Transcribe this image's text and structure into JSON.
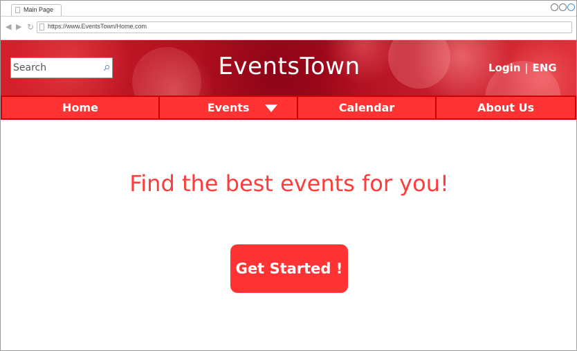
{
  "browser": {
    "tab_title": "Main Page",
    "url": "https://www.EventsTown/Home.com"
  },
  "header": {
    "search_placeholder": "Search",
    "brand": "EventsTown",
    "login_label": "Login",
    "separator": "|",
    "language_label": "ENG"
  },
  "nav": {
    "items": [
      {
        "label": "Home"
      },
      {
        "label": "Events"
      },
      {
        "label": "Calendar"
      },
      {
        "label": "About Us"
      }
    ]
  },
  "main": {
    "headline": "Find the best events for you!",
    "cta_label": "Get Started !"
  },
  "colors": {
    "primary_red": "#ff3333",
    "border_red": "#cc0000",
    "headline_red": "#ff3b3b"
  }
}
